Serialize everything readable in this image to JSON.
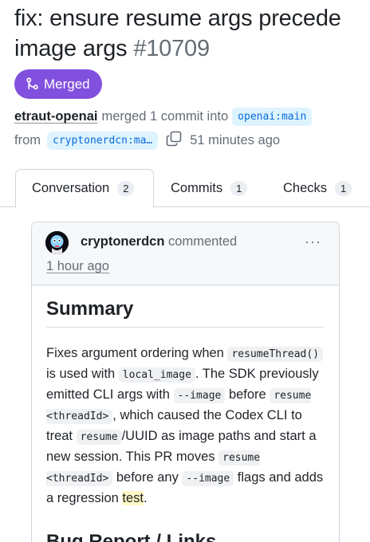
{
  "pr": {
    "title": "fix: ensure resume args precede image args",
    "number": "#10709",
    "status": "Merged",
    "author": "etraut-openai",
    "merged_text": "merged 1 commit into",
    "base_branch": "openai:main",
    "from_text": "from",
    "head_branch": "cryptonerdcn:ma…",
    "time": "51 minutes ago"
  },
  "tabs": [
    {
      "label": "Conversation",
      "count": "2"
    },
    {
      "label": "Commits",
      "count": "1"
    },
    {
      "label": "Checks",
      "count": "1"
    }
  ],
  "comment": {
    "author": "cryptonerdcn",
    "action": "commented",
    "timestamp": "1 hour ago",
    "menu": "···",
    "heading": "Summary",
    "body": {
      "t1": "Fixes argument ordering when ",
      "c1": "resumeThread()",
      "t2": " is used with ",
      "c2": "local_image",
      "t3": ". The SDK previously emitted CLI args with ",
      "c3": "--image",
      "t4": " before ",
      "c4": "resume <threadId>",
      "t5": ", which caused the Codex CLI to treat ",
      "c5": "resume",
      "t6": "/UUID as image paths and start a new session. This PR moves ",
      "c6": "resume <threadId>",
      "t7": " before any ",
      "c7": "--image",
      "t8": " flags and adds a regression ",
      "t9": "test",
      "t10": "."
    },
    "heading2": "Bug Report / Links"
  },
  "colors": {
    "merged": "#8250df",
    "link": "#0969da",
    "branch_bg": "#ddf4ff",
    "muted": "#656d76"
  }
}
